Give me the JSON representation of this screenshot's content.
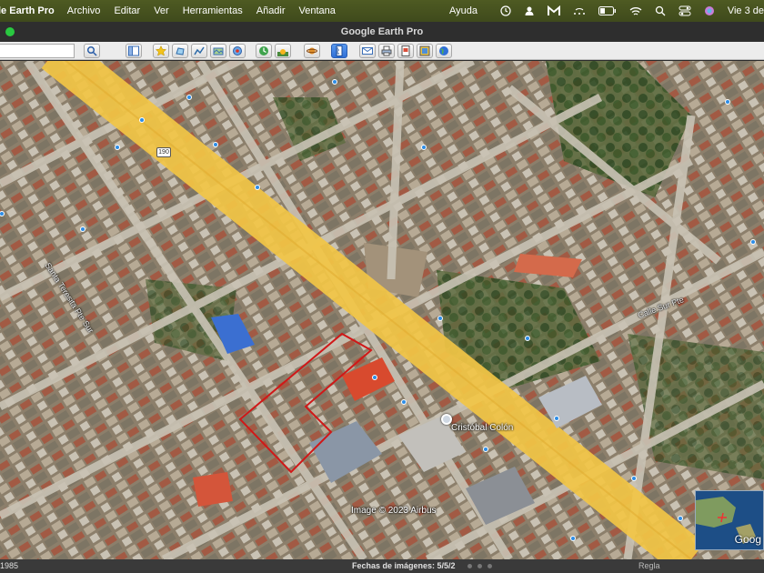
{
  "menubar": {
    "app_name": "le Earth Pro",
    "items": [
      "Archivo",
      "Editar",
      "Ver",
      "Herramientas",
      "Añadir",
      "Ventana"
    ],
    "help": "Ayuda",
    "clock": "Vie 3 de"
  },
  "window": {
    "title": "Google Earth Pro"
  },
  "toolbar": {
    "search_value": "",
    "tools": [
      "search-icon",
      "sidebar-icon",
      "placemark-icon",
      "polygon-icon",
      "path-icon",
      "overlay-icon",
      "tour-icon",
      "historical-imagery-icon",
      "sunlight-icon",
      "planets-icon",
      "ruler-icon",
      "email-icon",
      "print-icon",
      "save-image-icon",
      "kml-icon",
      "earth-icon"
    ]
  },
  "map": {
    "route_badge": "190",
    "street_label_1": "Santa Teresita Pte Sur",
    "street_label_2": "Calle Sur Pte",
    "poi_label": "Cristóbal Colón",
    "copyright": "Image © 2023 Airbus",
    "minimap_brand": "Goog"
  },
  "status": {
    "left": "1985",
    "imagery_date": "Fechas de imágenes: 5/5/2",
    "ruler": "Regla"
  },
  "colors": {
    "menubar": "#4e5a22",
    "highlight_road": "#f2c545",
    "parcel_outline": "#d01818"
  }
}
